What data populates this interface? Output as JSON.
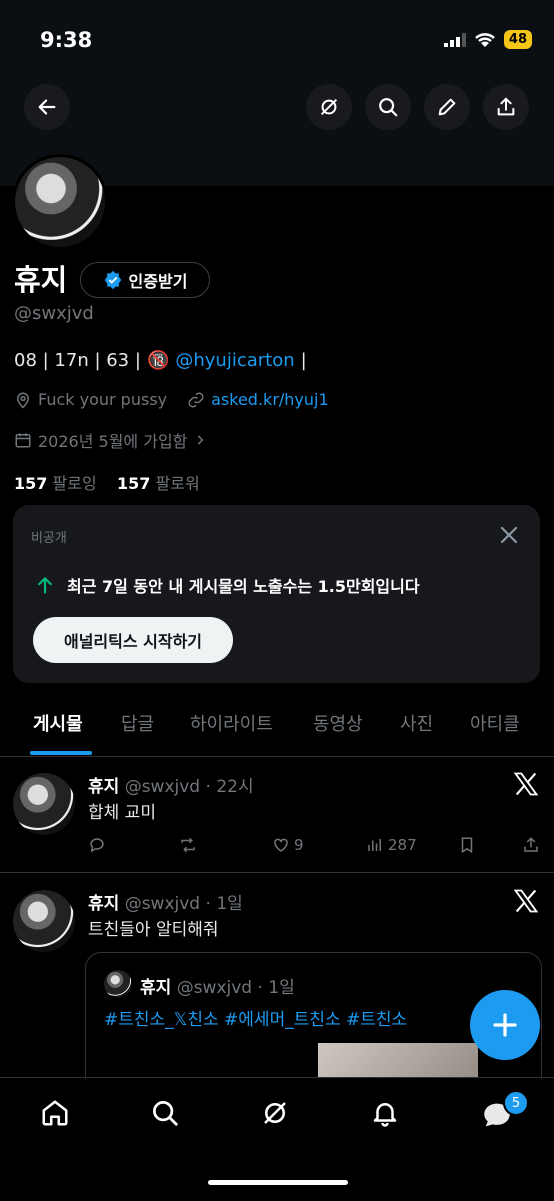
{
  "status": {
    "time": "9:38",
    "battery": "48"
  },
  "header": {
    "icons": [
      "back-arrow-icon",
      "grok-icon",
      "search-icon",
      "edit-icon",
      "share-icon"
    ]
  },
  "profile": {
    "name": "휴지",
    "verify_label": "인증받기",
    "handle": "@swxjvd",
    "bio_prefix": "08 | 17n | 63 |",
    "bio_emoji": "🔞",
    "bio_link": "@hyujicarton",
    "bio_suffix": "|",
    "location": "Fuck your pussy",
    "website": "asked.kr/hyuj1",
    "joined": "2026년 5월에 가입함",
    "following_count": "157",
    "following_label": "팔로잉",
    "followers_count": "157",
    "followers_label": "팔로워"
  },
  "analytics_card": {
    "title": "비공개",
    "text": "최근 7일 동안 내 게시물의 노출수는 1.5만회입니다",
    "button": "애널리틱스 시작하기"
  },
  "tabs": [
    "게시물",
    "답글",
    "하이라이트",
    "동영상",
    "사진",
    "아티클"
  ],
  "posts": [
    {
      "name": "휴지",
      "handle": "@swxjvd",
      "time": "22시",
      "text": "합체 교미",
      "likes": "9",
      "views": "287"
    },
    {
      "name": "휴지",
      "handle": "@swxjvd",
      "time": "1일",
      "text": "트친들아 알티해줘",
      "quote": {
        "name": "휴지",
        "handle": "@swxjvd",
        "time": "1일",
        "text": "#트친소_𝕏친소 #에세머_트친소 #트친소"
      }
    }
  ],
  "bottom_nav": {
    "messages_badge": "5"
  },
  "colors": {
    "accent": "#1d9bf0",
    "background": "#000000",
    "secondary_text": "#71767b"
  }
}
